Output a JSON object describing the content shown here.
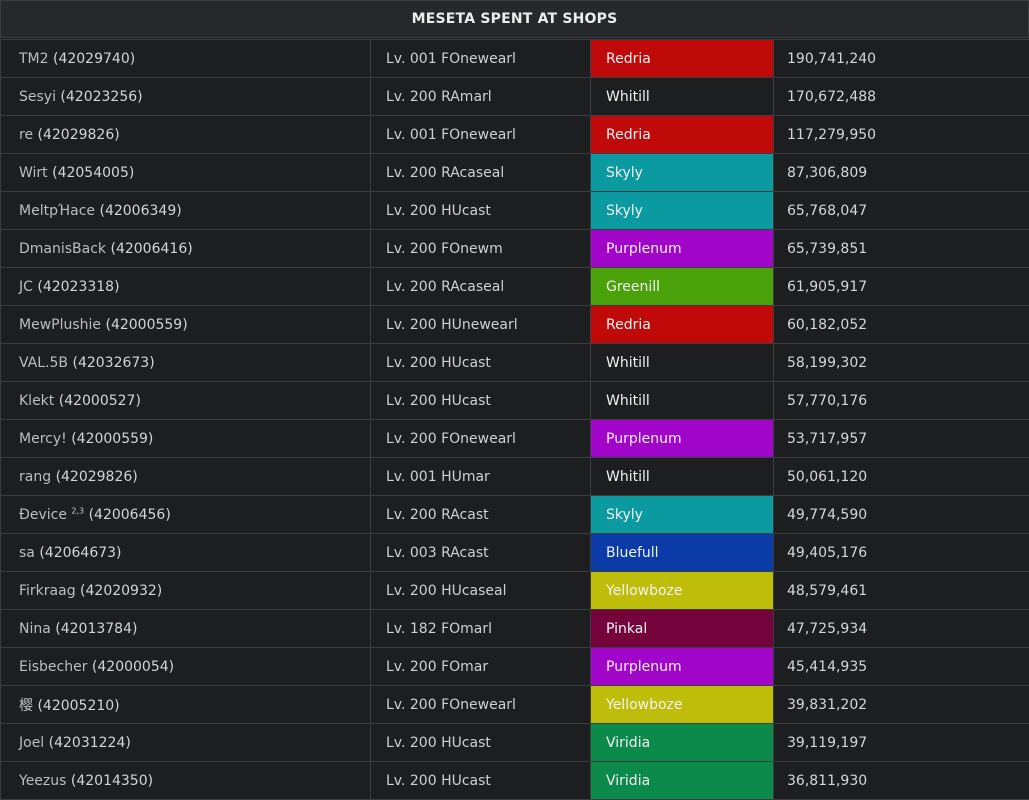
{
  "title": "MESETA SPENT AT SHOPS",
  "section_colors": {
    "Redria": "#c00a0a",
    "Whitill": "#1d1e20",
    "Skyly": "#0a9aa0",
    "Purplenum": "#a005c9",
    "Greenill": "#4aa10a",
    "Bluefull": "#0a3ba6",
    "Yellowboze": "#bebd0a",
    "Pinkal": "#74033b",
    "Viridia": "#0b8a4b"
  },
  "rows": [
    {
      "name": "TM2",
      "sup": "",
      "gid": "(42029740)",
      "level": "Lv. 001 FOnewearl",
      "section": "Redria",
      "meseta": "190,741,240"
    },
    {
      "name": "Sesyi",
      "sup": "",
      "gid": "(42023256)",
      "level": "Lv. 200 RAmarl",
      "section": "Whitill",
      "meseta": "170,672,488"
    },
    {
      "name": "re",
      "sup": "",
      "gid": "(42029826)",
      "level": "Lv. 001 FOnewearl",
      "section": "Redria",
      "meseta": "117,279,950"
    },
    {
      "name": "Wirt",
      "sup": "",
      "gid": "(42054005)",
      "level": "Lv. 200 RAcaseal",
      "section": "Skyly",
      "meseta": "87,306,809"
    },
    {
      "name": "MeltpΉace",
      "sup": "",
      "gid": "(42006349)",
      "level": "Lv. 200 HUcast",
      "section": "Skyly",
      "meseta": "65,768,047"
    },
    {
      "name": "DmanisBack",
      "sup": "",
      "gid": "(42006416)",
      "level": "Lv. 200 FOnewm",
      "section": "Purplenum",
      "meseta": "65,739,851"
    },
    {
      "name": "JC",
      "sup": "",
      "gid": "(42023318)",
      "level": "Lv. 200 RAcaseal",
      "section": "Greenill",
      "meseta": "61,905,917"
    },
    {
      "name": "MewPlushie",
      "sup": "",
      "gid": "(42000559)",
      "level": "Lv. 200 HUnewearl",
      "section": "Redria",
      "meseta": "60,182,052"
    },
    {
      "name": "VAL.5B",
      "sup": "",
      "gid": "(42032673)",
      "level": "Lv. 200 HUcast",
      "section": "Whitill",
      "meseta": "58,199,302"
    },
    {
      "name": "Klekt",
      "sup": "",
      "gid": "(42000527)",
      "level": "Lv. 200 HUcast",
      "section": "Whitill",
      "meseta": "57,770,176"
    },
    {
      "name": "Mercy!",
      "sup": "",
      "gid": "(42000559)",
      "level": "Lv. 200 FOnewearl",
      "section": "Purplenum",
      "meseta": "53,717,957"
    },
    {
      "name": "rang",
      "sup": "",
      "gid": "(42029826)",
      "level": "Lv. 001 HUmar",
      "section": "Whitill",
      "meseta": "50,061,120"
    },
    {
      "name": "Ðevice",
      "sup": "2,3",
      "gid": "(42006456)",
      "level": "Lv. 200 RAcast",
      "section": "Skyly",
      "meseta": "49,774,590"
    },
    {
      "name": "sa",
      "sup": "",
      "gid": "(42064673)",
      "level": "Lv. 003 RAcast",
      "section": "Bluefull",
      "meseta": "49,405,176"
    },
    {
      "name": "Firkraag",
      "sup": "",
      "gid": "(42020932)",
      "level": "Lv. 200 HUcaseal",
      "section": "Yellowboze",
      "meseta": "48,579,461"
    },
    {
      "name": "Nina",
      "sup": "",
      "gid": "(42013784)",
      "level": "Lv. 182 FOmarl",
      "section": "Pinkal",
      "meseta": "47,725,934"
    },
    {
      "name": "Eisbecher",
      "sup": "",
      "gid": "(42000054)",
      "level": "Lv. 200 FOmar",
      "section": "Purplenum",
      "meseta": "45,414,935"
    },
    {
      "name": "樱",
      "sup": "",
      "gid": "(42005210)",
      "level": "Lv. 200 FOnewearl",
      "section": "Yellowboze",
      "meseta": "39,831,202"
    },
    {
      "name": "Joel",
      "sup": "",
      "gid": "(42031224)",
      "level": "Lv. 200 HUcast",
      "section": "Viridia",
      "meseta": "39,119,197"
    },
    {
      "name": "Yeezus",
      "sup": "",
      "gid": "(42014350)",
      "level": "Lv. 200 HUcast",
      "section": "Viridia",
      "meseta": "36,811,930"
    }
  ]
}
